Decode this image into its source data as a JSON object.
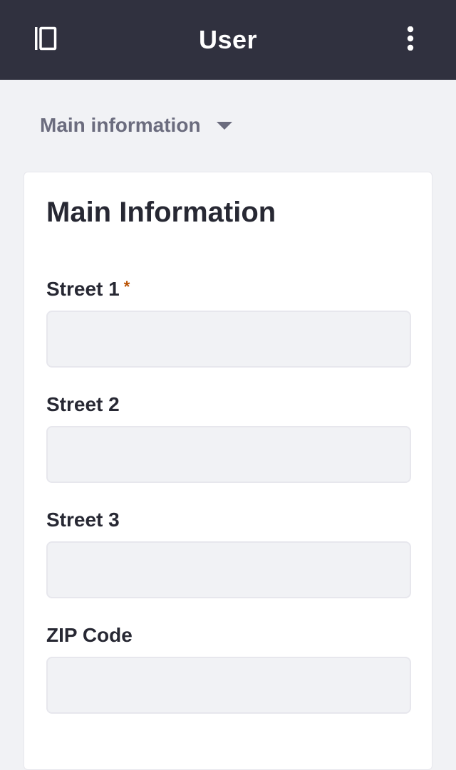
{
  "header": {
    "title": "User",
    "sidebar_icon": "sidebar-panel-icon",
    "menu_icon": "vertical-ellipsis-icon"
  },
  "section_nav": {
    "label": "Main information",
    "icon": "caret-down-icon"
  },
  "form": {
    "title": "Main Information",
    "fields": [
      {
        "label": "Street 1",
        "required": true,
        "required_mark": "*",
        "value": ""
      },
      {
        "label": "Street 2",
        "required": false,
        "value": ""
      },
      {
        "label": "Street 3",
        "required": false,
        "value": ""
      },
      {
        "label": "ZIP Code",
        "required": false,
        "value": ""
      }
    ]
  },
  "colors": {
    "header_bg": "#30313f",
    "page_bg": "#f1f2f5",
    "required": "#b95000",
    "text_dark": "#272833",
    "text_muted": "#6b6c7e"
  }
}
